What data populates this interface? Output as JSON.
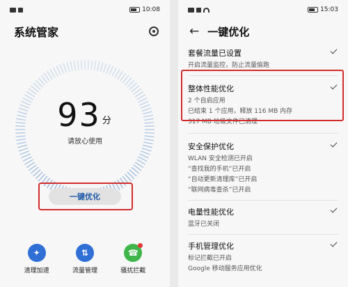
{
  "left": {
    "status": {
      "time": "10:08"
    },
    "title": "系统管家",
    "score": {
      "value": "93",
      "unit": "分",
      "subtitle": "请放心使用"
    },
    "optimize_button": "一键优化",
    "tools": [
      {
        "label": "清理加速",
        "icon": "broom-icon",
        "color": "#2f6fd6"
      },
      {
        "label": "流量管理",
        "icon": "data-arrows-icon",
        "color": "#2f6fd6"
      },
      {
        "label": "骚扰拦截",
        "icon": "phone-block-icon",
        "color": "#3fb54a"
      }
    ]
  },
  "right": {
    "status": {
      "time": "15:03"
    },
    "title": "一键优化",
    "items": [
      {
        "title": "套餐流量已设置",
        "lines": [
          "开启流量监控，防止流量偷跑"
        ]
      },
      {
        "title": "整体性能优化",
        "lines": [
          "2 个自启应用",
          "已结束 1 个应用，释放 116 MB 内存",
          "317 MB 垃圾文件已清理"
        ]
      },
      {
        "title": "安全保护优化",
        "lines": [
          "WLAN 安全检测已开启",
          "“查找我的手机”已开启",
          "“自动更新清理库”已开启",
          "“联网病毒查杀”已开启"
        ]
      },
      {
        "title": "电量性能优化",
        "lines": [
          "蓝牙已关闭"
        ]
      },
      {
        "title": "手机管理优化",
        "lines": [
          "标记拦截已开启",
          "Google 移动服务应用优化"
        ]
      }
    ]
  },
  "colors": {
    "highlight": "#d22b2b",
    "accent_blue": "#1f5aa8",
    "dial": "#7fa7d8"
  }
}
